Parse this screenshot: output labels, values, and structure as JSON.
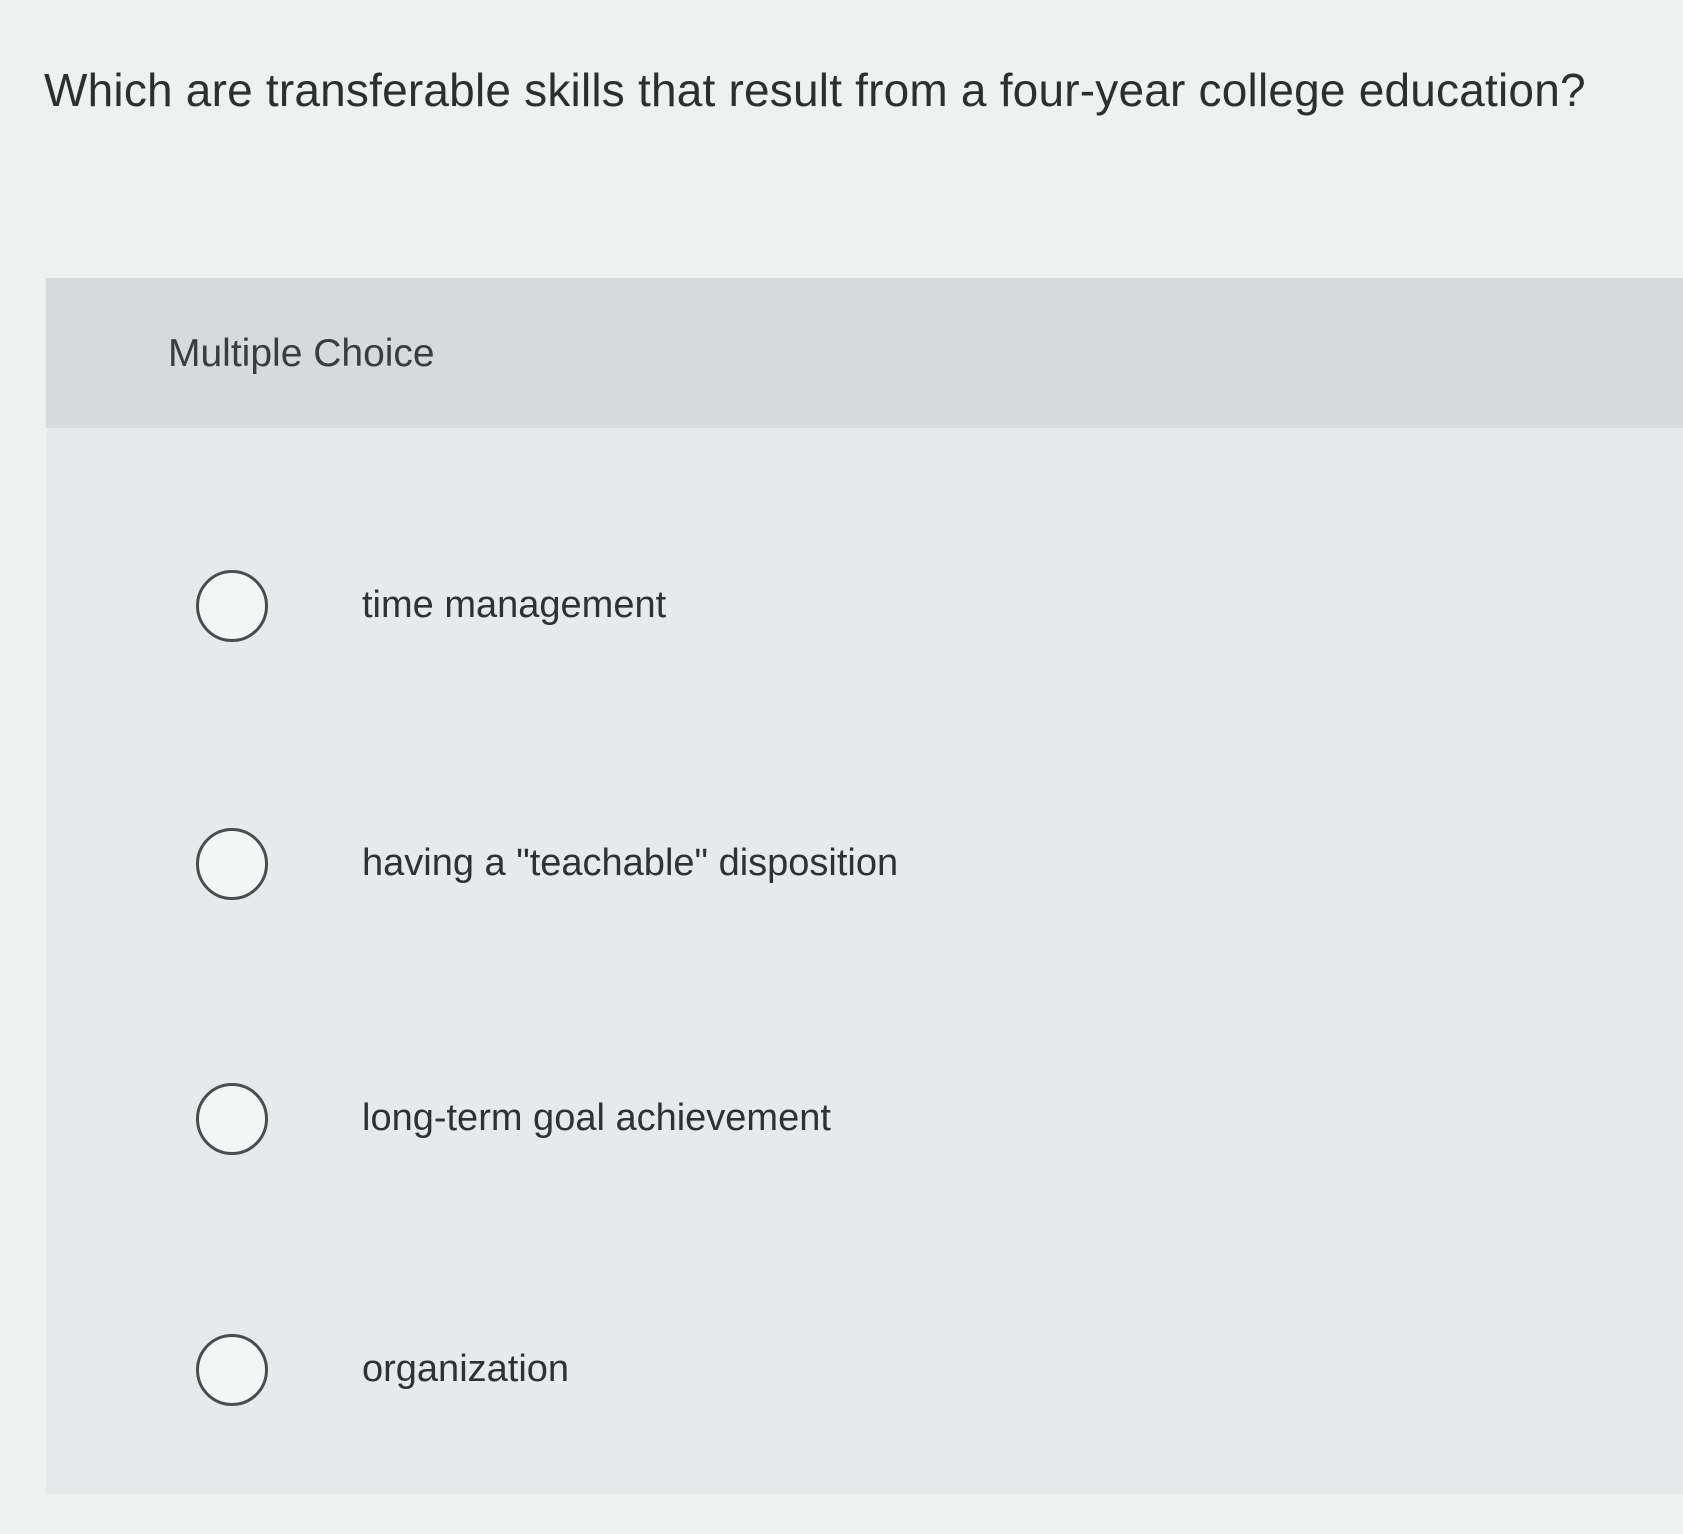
{
  "question": {
    "text": "Which are transferable skills that result from a four-year college education?"
  },
  "section": {
    "label": "Multiple Choice"
  },
  "choices": [
    {
      "label": "time management"
    },
    {
      "label": "having a \"teachable\" disposition"
    },
    {
      "label": "long-term goal achievement"
    },
    {
      "label": "organization"
    }
  ]
}
